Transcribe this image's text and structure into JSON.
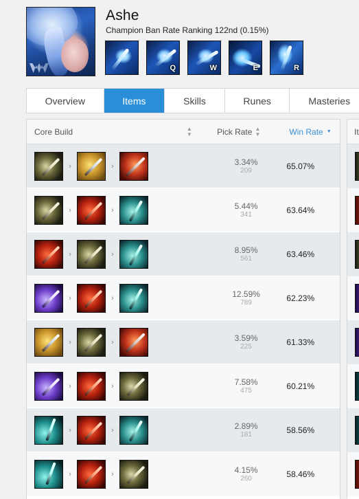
{
  "champion": {
    "name": "Ashe",
    "ban_rate_text": "Champion Ban Rate Ranking 122nd (0.15%)",
    "portrait_icon": "ashe-portrait"
  },
  "skills": [
    {
      "key": "",
      "icon": "frost-shot-passive-icon"
    },
    {
      "key": "Q",
      "icon": "rangers-focus-icon"
    },
    {
      "key": "W",
      "icon": "volley-icon"
    },
    {
      "key": "E",
      "icon": "hawkshot-icon"
    },
    {
      "key": "R",
      "icon": "enchanted-crystal-arrow-icon"
    }
  ],
  "tabs": [
    {
      "label": "Overview",
      "active": false
    },
    {
      "label": "Items",
      "active": true
    },
    {
      "label": "Skills",
      "active": false
    },
    {
      "label": "Runes",
      "active": false
    },
    {
      "label": "Masteries",
      "active": false
    }
  ],
  "table": {
    "headers": {
      "core": "Core Build",
      "pick": "Pick Rate",
      "win": "Win Rate"
    },
    "right_header": "It",
    "rows": [
      {
        "items": [
          "blade",
          "yuntal",
          "edge"
        ],
        "pick_rate": "3.34%",
        "pick_count": "209",
        "win_rate": "65.07%"
      },
      {
        "items": [
          "blade",
          "rfc",
          "bork"
        ],
        "pick_rate": "5.44%",
        "pick_count": "341",
        "win_rate": "63.64%"
      },
      {
        "items": [
          "rfc",
          "blade",
          "bork"
        ],
        "pick_rate": "8.95%",
        "pick_count": "561",
        "win_rate": "63.46%"
      },
      {
        "items": [
          "void",
          "rfc",
          "bork"
        ],
        "pick_rate": "12.59%",
        "pick_count": "789",
        "win_rate": "62.23%"
      },
      {
        "items": [
          "yuntal",
          "blade",
          "edge"
        ],
        "pick_rate": "3.59%",
        "pick_count": "225",
        "win_rate": "61.33%"
      },
      {
        "items": [
          "void",
          "rfc",
          "blade"
        ],
        "pick_rate": "7.58%",
        "pick_count": "475",
        "win_rate": "60.21%"
      },
      {
        "items": [
          "guinsoo",
          "rfc",
          "bork"
        ],
        "pick_rate": "2.89%",
        "pick_count": "181",
        "win_rate": "58.56%"
      },
      {
        "items": [
          "guinsoo",
          "rfc",
          "blade"
        ],
        "pick_rate": "4.15%",
        "pick_count": "260",
        "win_rate": "58.46%"
      }
    ]
  },
  "item_icons": {
    "blade": "blade-of-the-ruined-king-icon",
    "yuntal": "yuntal-wildarrows-icon",
    "edge": "infinity-edge-icon",
    "rfc": "rapid-firecannon-icon",
    "bork": "blade-of-ruined-king-teal-icon",
    "void": "void-staff-blade-icon",
    "guinsoo": "guinsoos-rageblade-icon"
  },
  "colors": {
    "accent": "#2a8fd8",
    "win_header": "#3a8fd6",
    "row_odd": "#e7eaed",
    "row_even": "#f7f8f9"
  }
}
